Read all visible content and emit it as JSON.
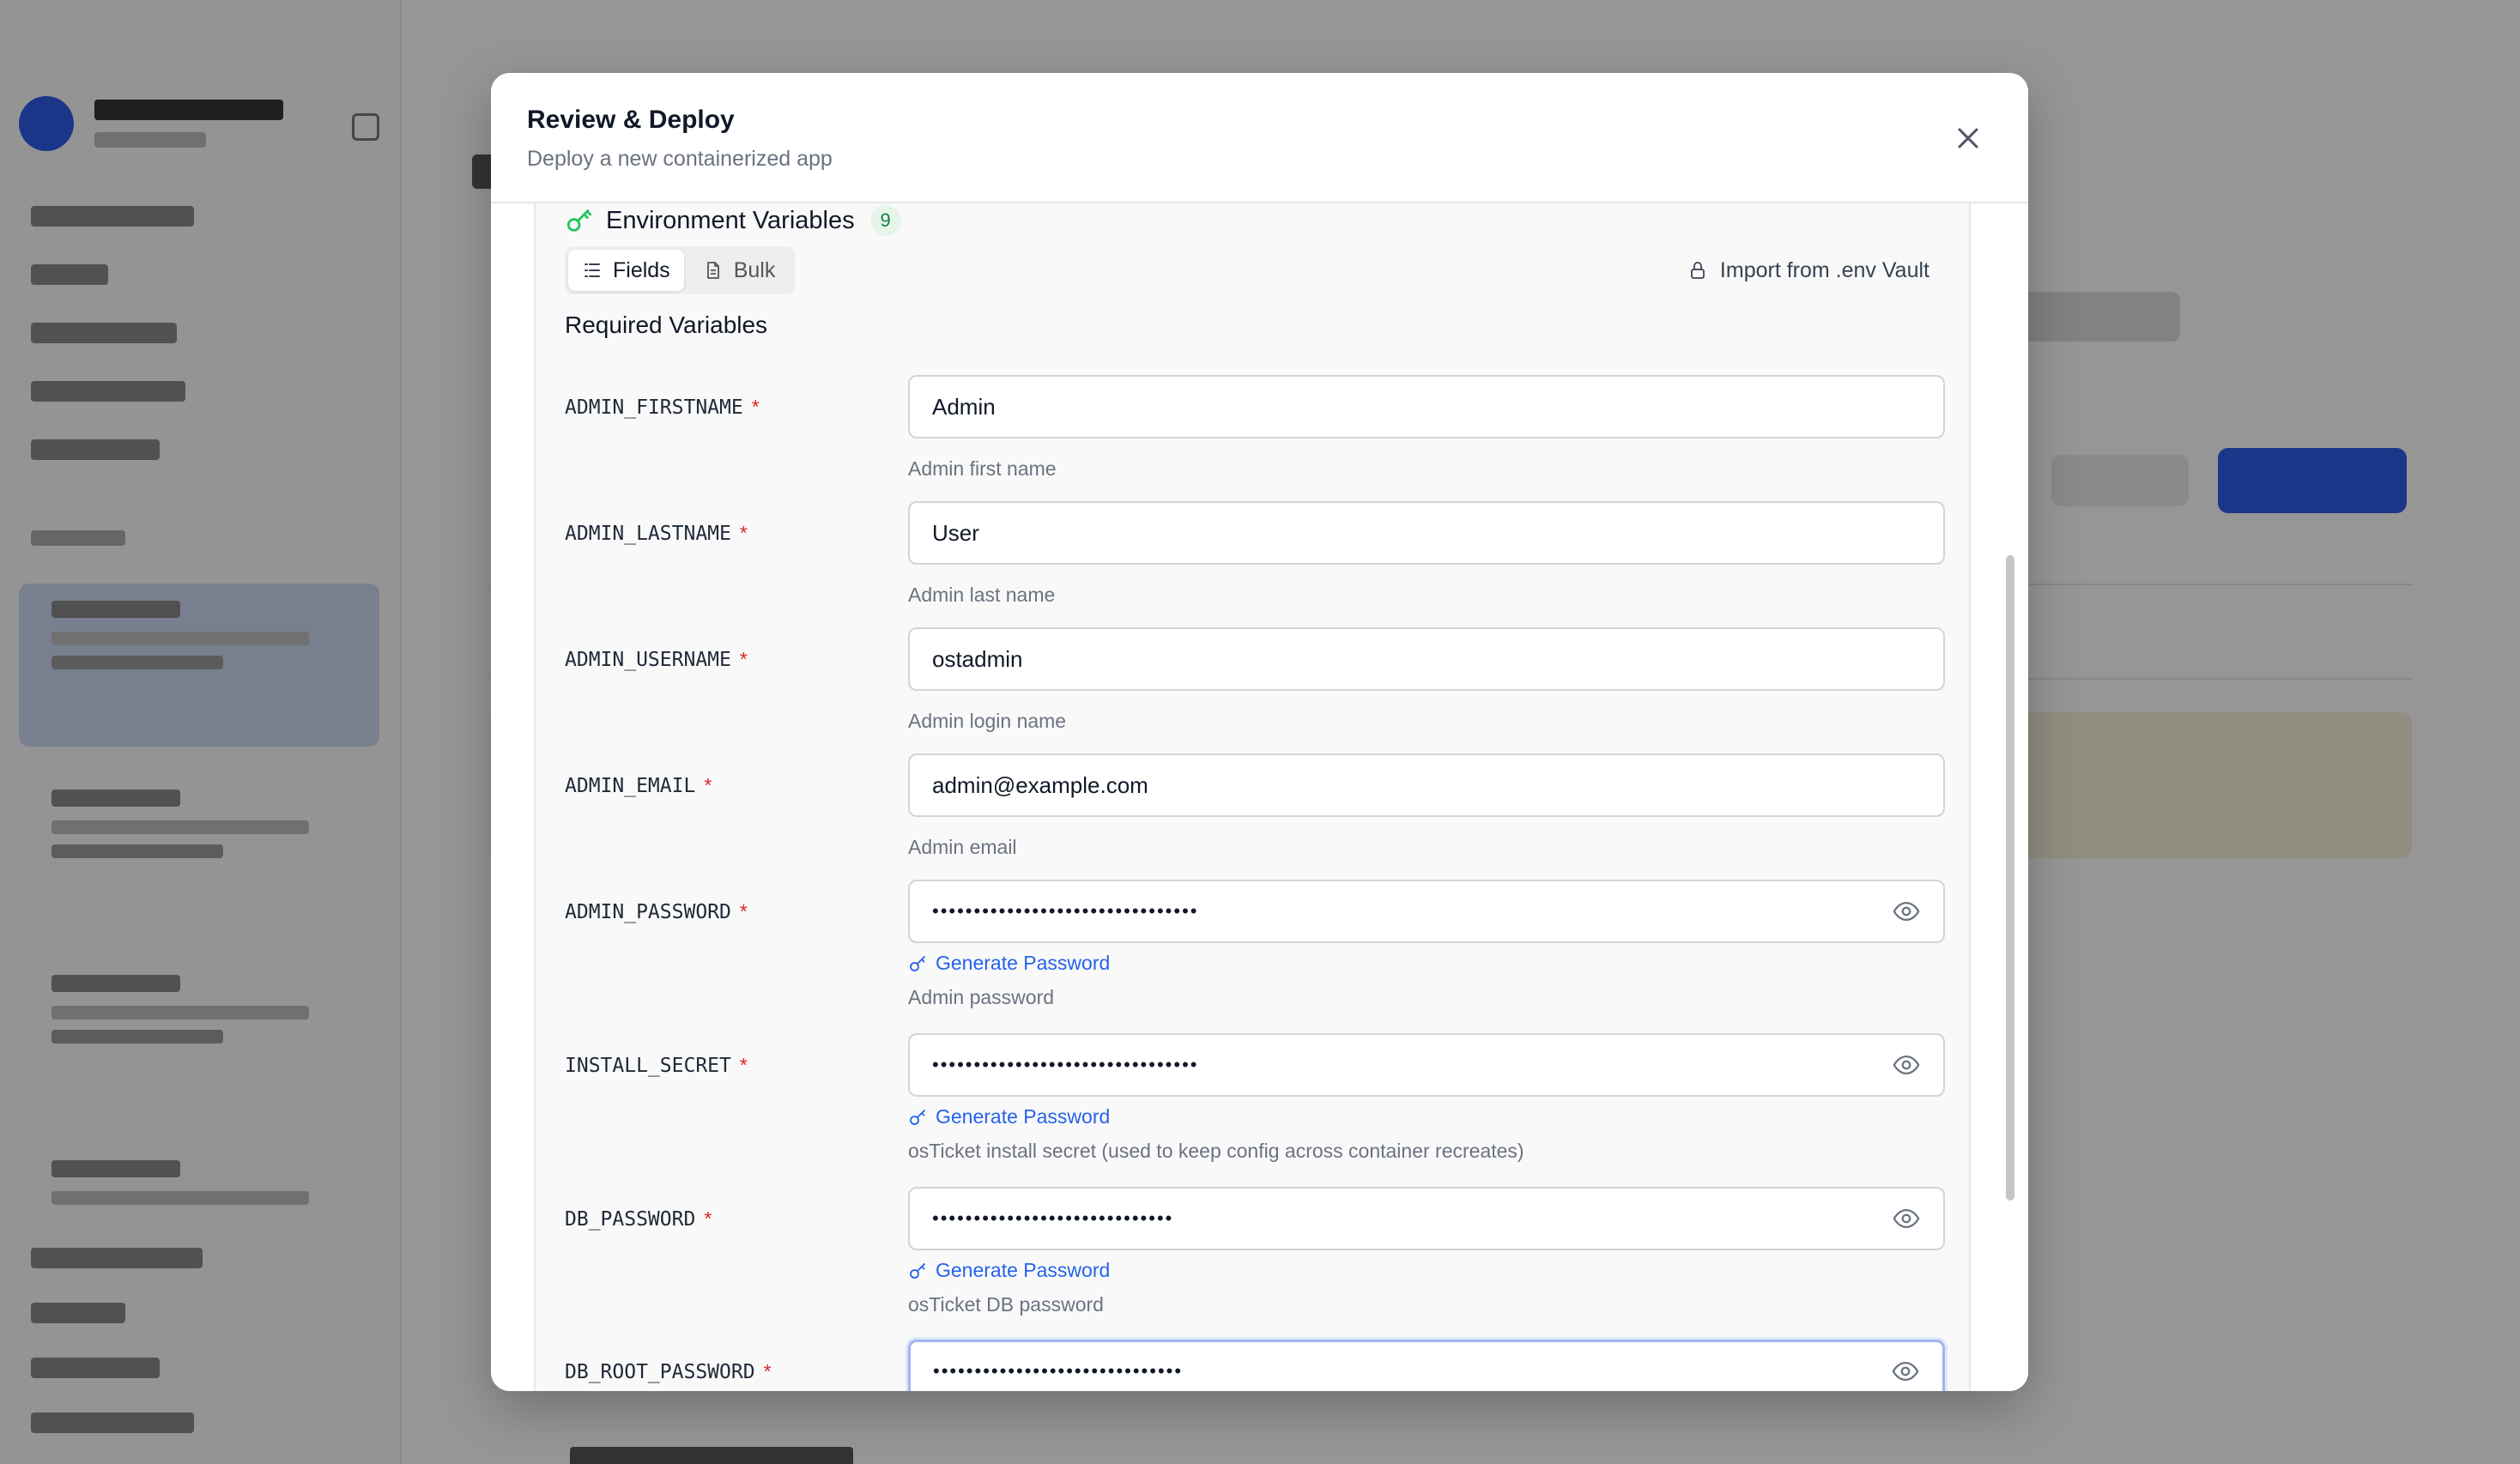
{
  "modal": {
    "title": "Review & Deploy",
    "subtitle": "Deploy a new containerized app"
  },
  "env": {
    "title": "Environment Variables",
    "count": "9",
    "tabs": [
      {
        "label": "Fields",
        "active": true,
        "icon": "list-icon"
      },
      {
        "label": "Bulk",
        "active": false,
        "icon": "file-icon"
      }
    ],
    "import_label": "Import from .env Vault",
    "required_title": "Required Variables",
    "generate_label": "Generate Password",
    "variables": [
      {
        "name": "ADMIN_FIRSTNAME",
        "required": "*",
        "value": "Admin",
        "help": "Admin first name",
        "secret": false
      },
      {
        "name": "ADMIN_LASTNAME",
        "required": "*",
        "value": "User",
        "help": "Admin last name",
        "secret": false
      },
      {
        "name": "ADMIN_USERNAME",
        "required": "*",
        "value": "ostadmin",
        "help": "Admin login name",
        "secret": false
      },
      {
        "name": "ADMIN_EMAIL",
        "required": "*",
        "value": "admin@example.com",
        "help": "Admin email",
        "secret": false
      },
      {
        "name": "ADMIN_PASSWORD",
        "required": "*",
        "value": "••••••••••••••••••••••••••••••••",
        "help": "Admin password",
        "secret": true
      },
      {
        "name": "INSTALL_SECRET",
        "required": "*",
        "value": "••••••••••••••••••••••••••••••••",
        "help": "osTicket install secret (used to keep config across container recreates)",
        "secret": true
      },
      {
        "name": "DB_PASSWORD",
        "required": "*",
        "value": "•••••••••••••••••••••••••••••",
        "help": "osTicket DB password",
        "secret": true
      },
      {
        "name": "DB_ROOT_PASSWORD",
        "required": "*",
        "value": "••••••••••••••••••••••••••••••",
        "help": "",
        "secret": true
      }
    ]
  },
  "colors": {
    "accent": "#2563eb",
    "required": "#dc2626",
    "count_badge_bg": "#e6f4ea",
    "count_badge_text": "#15803d",
    "key_icon": "#22c55e"
  }
}
